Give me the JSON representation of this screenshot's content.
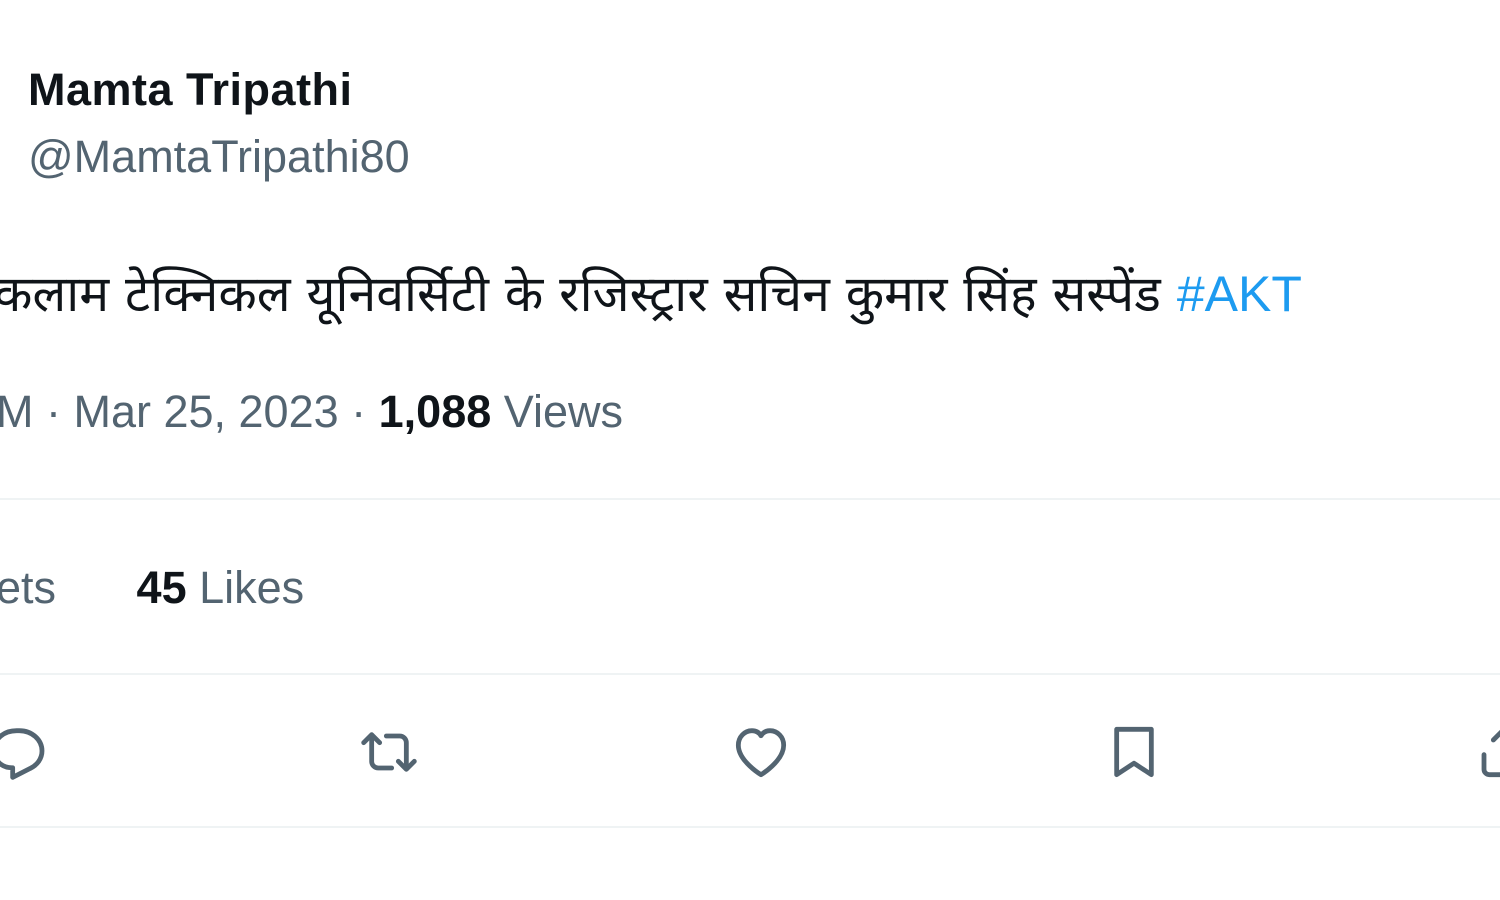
{
  "author": {
    "name": "Mamta Tripathi",
    "handle": "@MamtaTripathi80"
  },
  "tweet": {
    "text": "कलाम टेक्निकल यूनिवर्सिटी के रजिस्ट्रार सचिन कुमार सिंह सस्पेंड",
    "hashtag": "#AKT"
  },
  "meta": {
    "time_fragment": "M · Mar 25, 2023 ·",
    "views_count": "1,088",
    "views_label": "Views"
  },
  "stats": {
    "retweets_fragment": "ets",
    "likes_count": "45",
    "likes_label": "Likes"
  },
  "actions": {
    "icons": [
      "reply-icon",
      "retweet-icon",
      "like-icon",
      "bookmark-icon",
      "share-icon"
    ],
    "icon_color": "#536471"
  },
  "colors": {
    "text": "#0f1419",
    "secondary": "#536471",
    "accent": "#1d9bf0",
    "divider": "#eff3f4"
  }
}
